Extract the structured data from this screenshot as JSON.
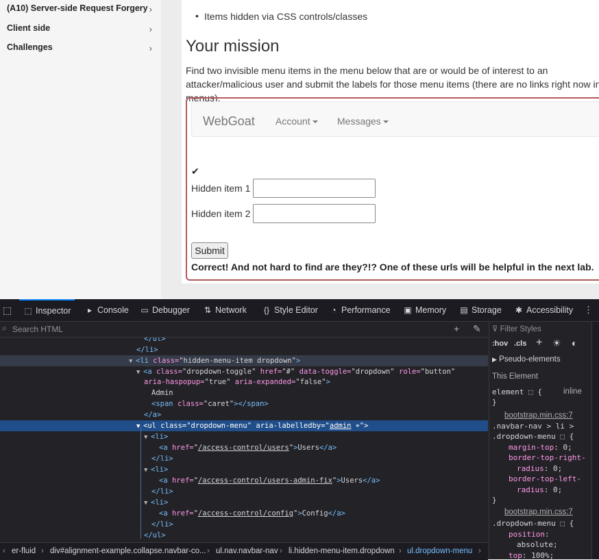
{
  "sidebar": {
    "items": [
      {
        "label": "(A10) Server-side Request Forgery"
      },
      {
        "label": "Client side"
      },
      {
        "label": "Challenges"
      }
    ],
    "chevron": "›"
  },
  "content": {
    "bullet": "Items hidden via CSS controls/classes",
    "mission_heading": "Your mission",
    "mission_text": "Find two invisible menu items in the menu below that are or would be of interest to an attacker/malicious user and submit the labels for those menu items (there are no links right now in the menus).",
    "navbar": {
      "brand": "WebGoat",
      "account": "Account",
      "messages": "Messages"
    },
    "check": "✔",
    "fields": [
      {
        "label": "Hidden item 1",
        "value": ""
      },
      {
        "label": "Hidden item 2",
        "value": ""
      }
    ],
    "submit": "Submit",
    "feedback": "Correct! And not hard to find are they?!? One of these urls will be helpful in the next lab."
  },
  "devtools": {
    "tabs": [
      {
        "label": "Inspector",
        "icon": "inspector-icon"
      },
      {
        "label": "Console",
        "icon": "console-icon"
      },
      {
        "label": "Debugger",
        "icon": "debugger-icon"
      },
      {
        "label": "Network",
        "icon": "network-icon"
      },
      {
        "label": "Style Editor",
        "icon": "style-editor-icon"
      },
      {
        "label": "Performance",
        "icon": "performance-icon"
      },
      {
        "label": "Memory",
        "icon": "memory-icon"
      },
      {
        "label": "Storage",
        "icon": "storage-icon"
      },
      {
        "label": "Accessibility",
        "icon": "accessibility-icon"
      }
    ],
    "search_placeholder": "Search HTML",
    "markup": {
      "l0": "</ul>",
      "l1": "</li>",
      "l2_tag": "<li",
      "l2_attr": "class=",
      "l2_val": "\"hidden-menu-item dropdown\"",
      "l2_end": ">",
      "l3a": "<a",
      "l3_class": "class=",
      "l3_class_v": "\"dropdown-toggle\"",
      "l3_href": "href=",
      "l3_href_v": "\"#\"",
      "l3_dt": "data-toggle=",
      "l3_dt_v": "\"dropdown\"",
      "l3_role": "role=",
      "l3_role_v": "\"button\"",
      "l4_hp": "aria-haspopup=",
      "l4_hp_v": "\"true\"",
      "l4_ex": "aria-expanded=",
      "l4_ex_v": "\"false\"",
      "l4_end": ">",
      "l5": "Admin",
      "l6_tag": "<span",
      "l6_attr": "class=",
      "l6_val": "\"caret\"",
      "l6_end": "></span>",
      "l7": "</a>",
      "l8_tag": "<ul",
      "l8_class": "class=",
      "l8_class_v": "\"dropdown-menu\"",
      "l8_lab": "aria-labelledby=",
      "l8_lab_v1": "\"",
      "l8_lab_v2": "admin",
      "l8_lab_v3": "\"",
      "l8_end": ">",
      "li_open": "<li>",
      "a_open": "<a",
      "href": "href=",
      "q": "\"",
      "u1": "/access-control/users",
      "t1": "Users",
      "u2": "/access-control/users-admin-fix",
      "t2": "Users",
      "u3": "/access-control/config",
      "t3": "Config",
      "a_close": "</a>",
      "li_close": "</li>",
      "ul_close": "</ul>"
    },
    "breadcrumbs": [
      "er-fluid",
      "div#alignment-example.collapse.navbar-co...",
      "ul.nav.navbar-nav",
      "li.hidden-menu-item.dropdown",
      "ul.dropdown-menu"
    ],
    "rules": {
      "filter_placeholder": "Filter Styles",
      "hov": ":hov",
      "cls": ".cls",
      "pseudo": "Pseudo-elements",
      "this_element": "This Element",
      "element": "element",
      "inline": "inline",
      "src1": "bootstrap.min.css:7",
      "sel1a": ".navbar-nav > li >",
      "sel1b": ".dropdown-menu",
      "p1": "margin-top",
      "v1": "0;",
      "p2a": "border-top-right-",
      "p2b": "radius",
      "v2": "0;",
      "p3a": "border-top-left-",
      "p3b": "radius",
      "v3": "0;",
      "src2": "bootstrap.min.css:7",
      "sel2": ".dropdown-menu",
      "p4": "position",
      "v4": "absolute;",
      "p5": "top",
      "v5": "100%;"
    }
  }
}
